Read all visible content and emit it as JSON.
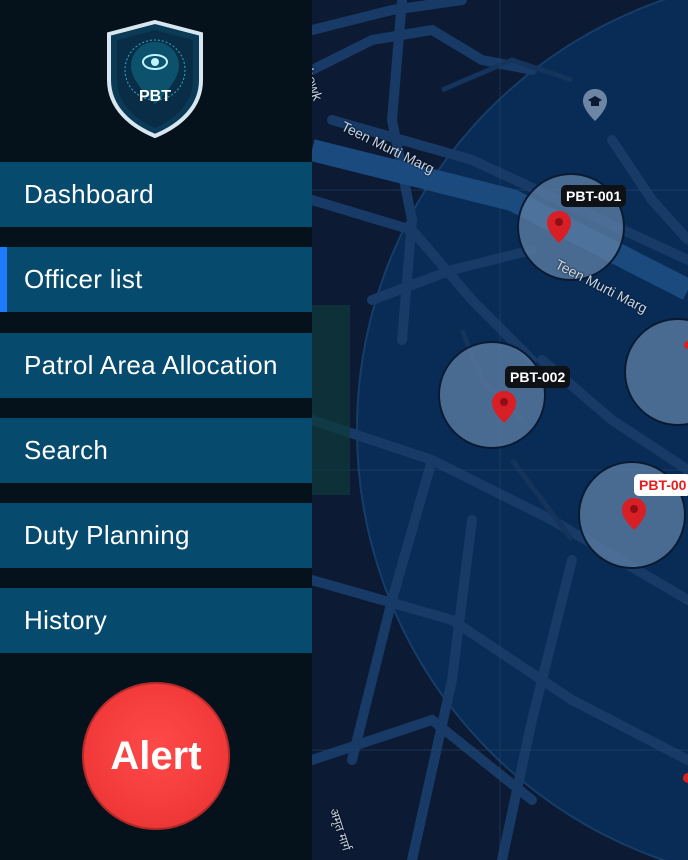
{
  "logo": {
    "text": "PBT"
  },
  "nav": [
    {
      "label": "Dashboard"
    },
    {
      "label": "Officer list"
    },
    {
      "label": "Patrol Area Allocation"
    },
    {
      "label": "Search"
    },
    {
      "label": "Duty Planning"
    },
    {
      "label": "History"
    }
  ],
  "alert": {
    "label": "Alert"
  },
  "map": {
    "streets": {
      "chowk": "ta Chowk",
      "teen_murti_1": "Teen Murti Marg",
      "teen_murti_2": "Teen Murti Marg",
      "hindi": "अमृत मार्ग"
    },
    "markers": [
      {
        "id": "PBT-001"
      },
      {
        "id": "PBT-002"
      },
      {
        "id": "PBT-00"
      }
    ]
  },
  "colors": {
    "nav_bg": "#064a6e",
    "active_bar": "#1e7bff",
    "alert": "#f23a3a",
    "sidebar": "#06121b"
  }
}
